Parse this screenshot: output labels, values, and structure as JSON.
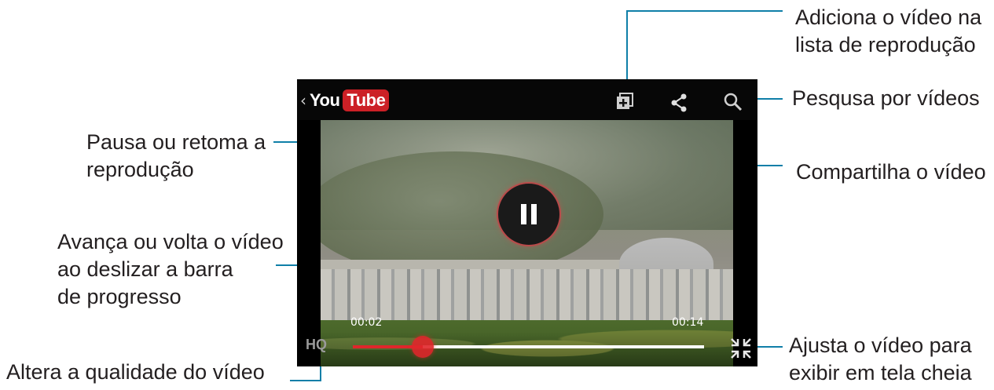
{
  "callouts": {
    "add_to_playlist": [
      "Adiciona o vídeo na",
      "lista de reprodução"
    ],
    "search": "Pesqusa por vídeos",
    "pause": [
      "Pausa ou retoma a",
      "reprodução"
    ],
    "share": "Compartilha o vídeo",
    "seek": [
      "Avança ou volta o vídeo",
      "ao deslizar a barra",
      "de progresso"
    ],
    "quality": "Altera a qualidade do vídeo",
    "fullscreen": [
      "Ajusta o vídeo para",
      "exibir em tela cheia"
    ]
  },
  "player": {
    "logo_you": "You",
    "logo_tube": "Tube",
    "back_glyph": "‹",
    "elapsed": "00:02",
    "duration": "00:14",
    "hq_label": "HQ",
    "progress": 0.2
  },
  "icons": {
    "add_to_playlist": "playlist-add-icon",
    "share": "share-icon",
    "search": "search-icon",
    "pause": "pause-icon",
    "exit_fullscreen": "exit-fullscreen-icon"
  },
  "colors": {
    "callout_line": "#0f7fa8",
    "progress_played": "#e0262b",
    "youtube_red": "#cc2026"
  }
}
